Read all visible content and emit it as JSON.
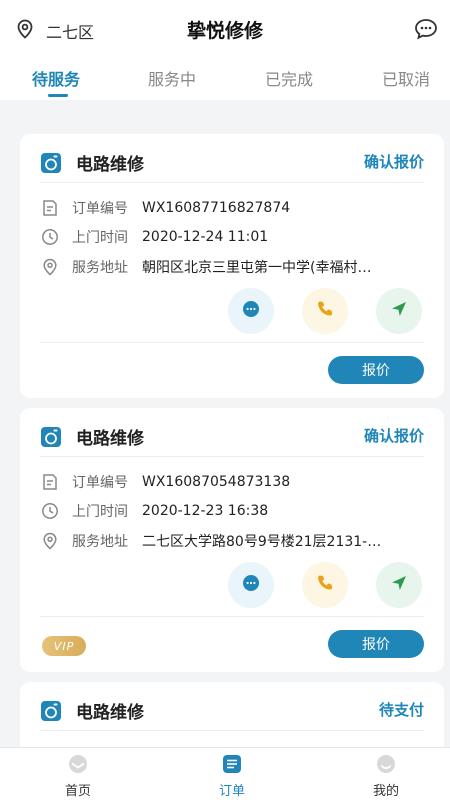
{
  "header": {
    "location": "二七区",
    "title": "挚悦修修"
  },
  "tabs": [
    {
      "label": "待服务",
      "active": true
    },
    {
      "label": "服务中",
      "active": false
    },
    {
      "label": "已完成",
      "active": false
    },
    {
      "label": "已取消",
      "active": false
    }
  ],
  "orders": [
    {
      "title": "电路维修",
      "status": "确认报价",
      "order_no_label": "订单编号",
      "order_no": "WX16087716827874",
      "time_label": "上门时间",
      "time": "2020-12-24 11:01",
      "address_label": "服务地址",
      "address": "朝阳区北京三里屯第一中学(幸福村…",
      "button": "报价",
      "vip": ""
    },
    {
      "title": "电路维修",
      "status": "确认报价",
      "order_no_label": "订单编号",
      "order_no": "WX16087054873138",
      "time_label": "上门时间",
      "time": "2020-12-23 16:38",
      "address_label": "服务地址",
      "address": "二七区大学路80号9号楼21层2131-…",
      "button": "报价",
      "vip": "VIP"
    },
    {
      "title": "电路维修",
      "status": "待支付"
    }
  ],
  "bottom_nav": [
    {
      "label": "首页",
      "active": false
    },
    {
      "label": "订单",
      "active": true
    },
    {
      "label": "我的",
      "active": false
    }
  ],
  "colors": {
    "accent": "#1f86b7",
    "phone": "#e8a317",
    "nav": "#2e9a4e",
    "vip": "#d9ad5a"
  }
}
